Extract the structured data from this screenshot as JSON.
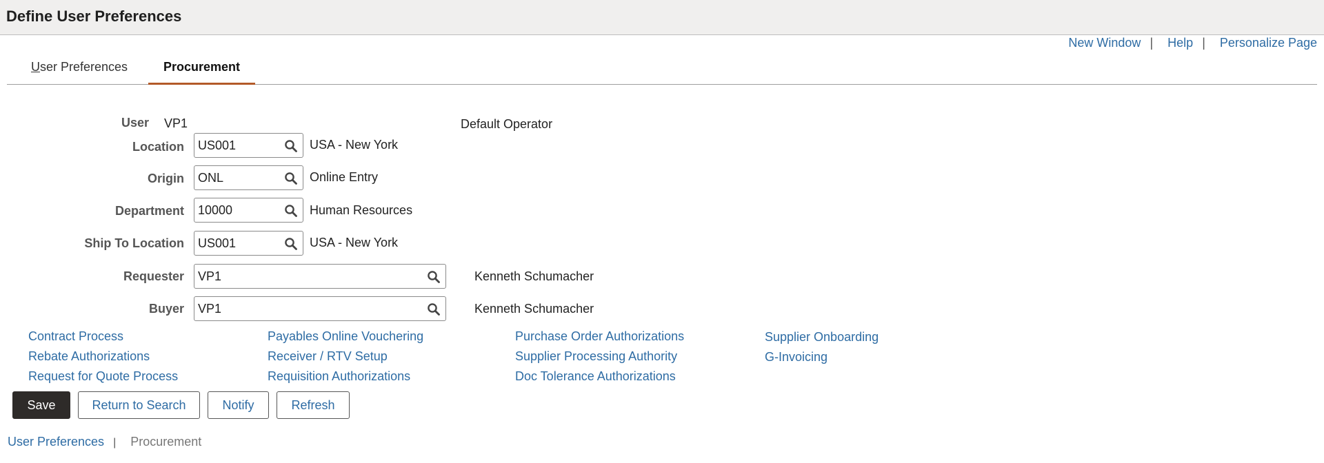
{
  "header": {
    "title": "Define User Preferences"
  },
  "toplinks": {
    "new_window": "New Window",
    "help": "Help",
    "personalize": "Personalize Page",
    "separator": "|"
  },
  "tabs": [
    {
      "label_first": "U",
      "label_rest": "ser Preferences"
    },
    {
      "label": "Procurement"
    }
  ],
  "form": {
    "user": {
      "label": "User",
      "value": "VP1",
      "description": "Default Operator"
    },
    "location": {
      "label": "Location",
      "value": "US001",
      "description": "USA - New York"
    },
    "origin": {
      "label": "Origin",
      "value": "ONL",
      "description": "Online Entry"
    },
    "department": {
      "label": "Department",
      "value": "10000",
      "description": "Human Resources"
    },
    "ship_to": {
      "label": "Ship To Location",
      "value": "US001",
      "description": "USA - New York"
    },
    "requester": {
      "label": "Requester",
      "value": "VP1",
      "description": "Kenneth Schumacher"
    },
    "buyer": {
      "label": "Buyer",
      "value": "VP1",
      "description": "Kenneth Schumacher"
    }
  },
  "links": {
    "col1": [
      "Contract Process",
      "Rebate Authorizations",
      "Request for Quote Process"
    ],
    "col2": [
      "Payables Online Vouchering",
      "Receiver / RTV Setup",
      "Requisition Authorizations"
    ],
    "col3": [
      "Purchase Order Authorizations",
      "Supplier Processing Authority",
      "Doc Tolerance Authorizations"
    ],
    "col4": [
      "Supplier Onboarding",
      "G-Invoicing"
    ]
  },
  "buttons": {
    "save": "Save",
    "return": "Return to Search",
    "notify": "Notify",
    "refresh": "Refresh"
  },
  "breadcrumb": {
    "link": "User Preferences",
    "separator": "|",
    "current": "Procurement"
  },
  "colors": {
    "link": "#2e6ca4",
    "tab_active_border": "#b35a28",
    "primary_button": "#2e2b29"
  },
  "icons": {
    "field_lookup": "search-icon"
  }
}
